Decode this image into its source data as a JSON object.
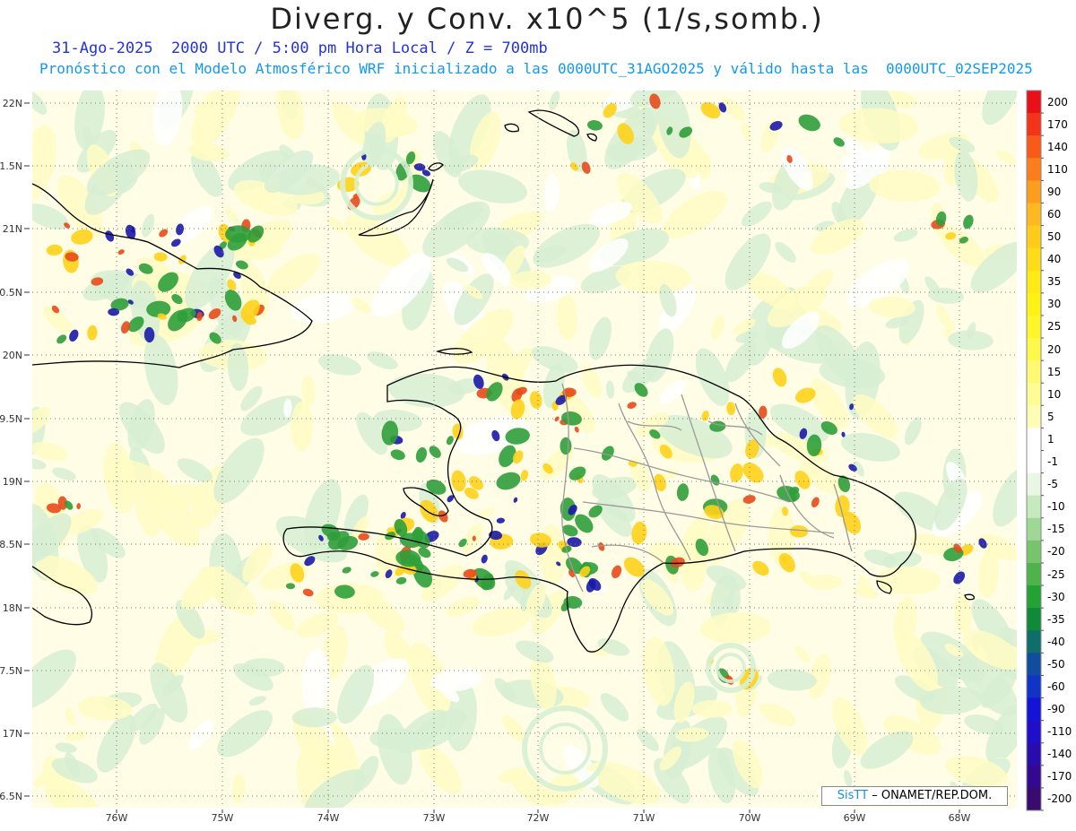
{
  "title": "Diverg. y Conv. x10^5 (1/s,somb.)",
  "subtitle_date": "31-Ago-2025  2000 UTC / 5:00 pm Hora Local / Z = 700mb",
  "subtitle_model": "Pronóstico con el Modelo Atmosférico WRF inicializado a las 0000UTC_31AGO2025 y válido hasta las  0000UTC_02SEP2025",
  "map": {
    "lat_ticks": [
      "22N",
      "1.5N",
      "21N",
      "0.5N",
      "20N",
      "9.5N",
      "19N",
      "8.5N",
      "18N",
      "7.5N",
      "17N",
      "6.5N"
    ],
    "lon_ticks": [
      "76W",
      "75W",
      "74W",
      "73W",
      "72W",
      "71W",
      "70W",
      "69W",
      "68W"
    ],
    "grid_style": "dotted",
    "colors": {
      "convergence_strong": "#1a1aa8",
      "convergence": "#2f9e3a",
      "convergence_weak": "#d7efd3",
      "divergence_weak": "#fffbc4",
      "divergence": "#ffd21a",
      "divergence_strong": "#e84a1a",
      "coastline": "#000000",
      "provinces": "#9a9a9a"
    }
  },
  "colorbar": {
    "levels": [
      "200",
      "170",
      "140",
      "110",
      "90",
      "60",
      "50",
      "40",
      "35",
      "30",
      "25",
      "20",
      "15",
      "10",
      "5",
      "1",
      "-1",
      "-5",
      "-10",
      "-15",
      "-20",
      "-25",
      "-30",
      "-35",
      "-40",
      "-50",
      "-60",
      "-90",
      "-110",
      "-140",
      "-170",
      "-200"
    ],
    "colors": [
      "#e8111a",
      "#f2351a",
      "#f85a1a",
      "#fb7e1c",
      "#fd9d1f",
      "#ffb81f",
      "#ffcc1c",
      "#ffdc19",
      "#ffea16",
      "#fff214",
      "#fff62a",
      "#fff84c",
      "#fffa72",
      "#fffb95",
      "#fffcb5",
      "#ffffff",
      "#ffffff",
      "#eaf6e4",
      "#c6e9bd",
      "#9fd796",
      "#78c46c",
      "#4fb24a",
      "#24a236",
      "#108a38",
      "#0e6e6a",
      "#104d9e",
      "#1234c6",
      "#1414d8",
      "#1f0fc8",
      "#2a0cad",
      "#330a8f",
      "#3a0a6e"
    ]
  },
  "credit": {
    "logo": "SisTT",
    "text": "– ONAMET/REP.DOM."
  }
}
